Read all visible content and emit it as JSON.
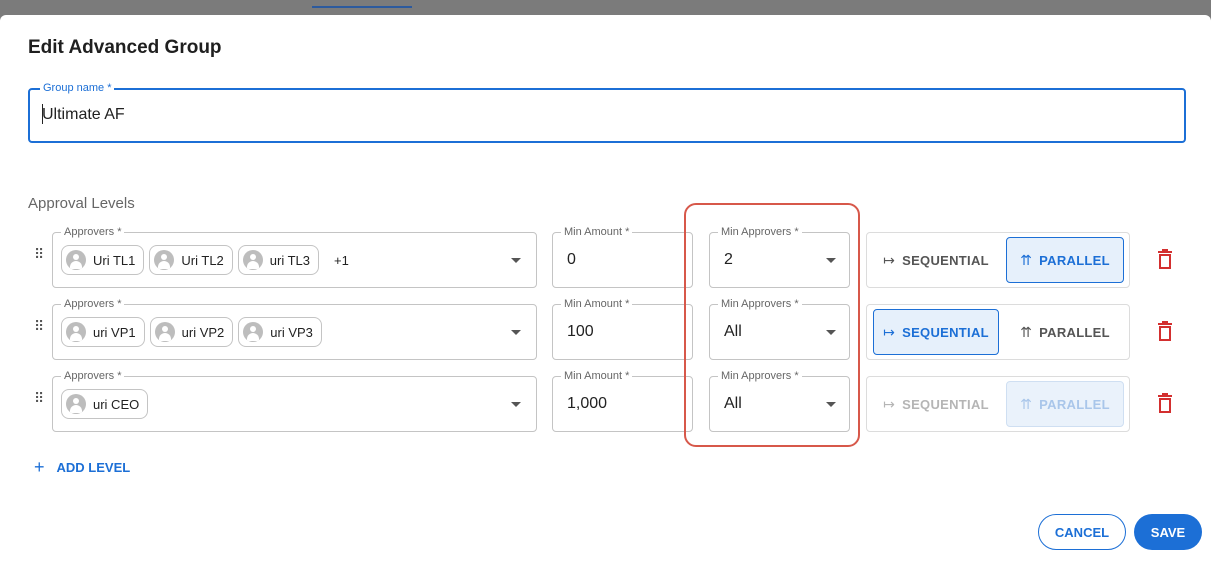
{
  "dialog": {
    "title": "Edit Advanced Group",
    "group_name_label": "Group name *",
    "group_name_value": "Ultimate AF",
    "section_label": "Approval Levels",
    "add_level_label": "ADD LEVEL",
    "cancel_label": "CANCEL",
    "save_label": "SAVE"
  },
  "labels": {
    "approvers": "Approvers *",
    "min_amount": "Min Amount *",
    "min_approvers": "Min Approvers *",
    "sequential": "SEQUENTIAL",
    "parallel": "PARALLEL"
  },
  "levels": [
    {
      "approvers": [
        "Uri TL1",
        "Uri TL2",
        "uri TL3"
      ],
      "more": "+1",
      "min_amount": "0",
      "min_approvers": "2",
      "mode": "parallel",
      "mode_state": "enabled"
    },
    {
      "approvers": [
        "uri VP1",
        "uri VP2",
        "uri VP3"
      ],
      "more": "",
      "min_amount": "100",
      "min_approvers": "All",
      "mode": "sequential",
      "mode_state": "enabled"
    },
    {
      "approvers": [
        "uri CEO"
      ],
      "more": "",
      "min_amount": "1,000",
      "min_approvers": "All",
      "mode": "parallel",
      "mode_state": "disabled"
    }
  ],
  "colors": {
    "accent": "#1c6fd6",
    "delete": "#d32f2f",
    "highlight": "#d7584a"
  },
  "icons": {
    "drag": "drag-handle-icon",
    "sequential": "sequential-arrow-icon",
    "parallel": "parallel-arrows-icon",
    "delete": "trash-icon",
    "dropdown": "chevron-down-icon",
    "add": "plus-icon"
  }
}
